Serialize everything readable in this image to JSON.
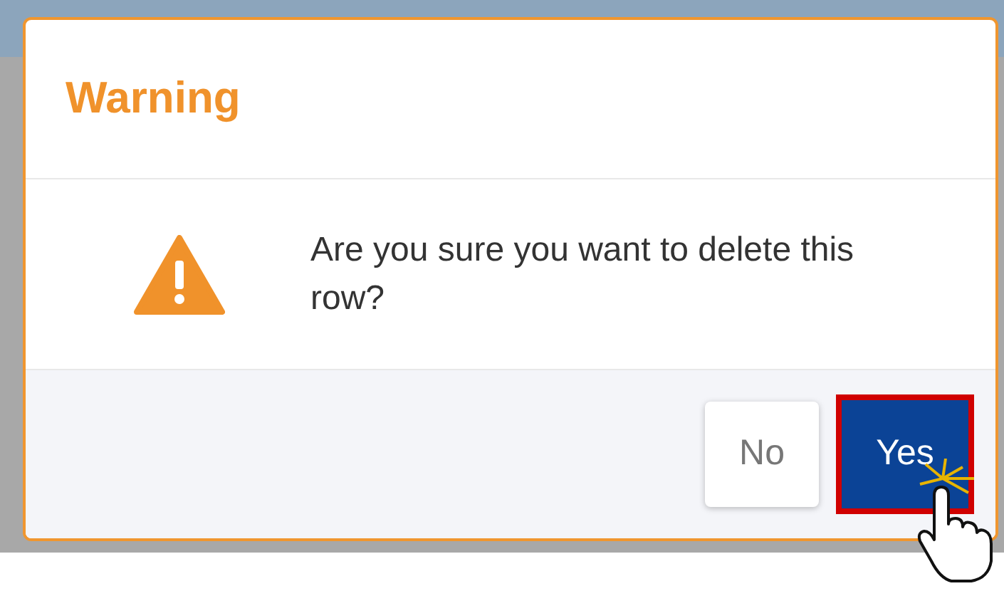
{
  "dialog": {
    "title": "Warning",
    "message": "Are you sure you want to delete this row?",
    "buttons": [
      {
        "label": "No",
        "kind": "secondary",
        "focused": false
      },
      {
        "label": "Yes",
        "kind": "primary",
        "focused": true
      }
    ]
  }
}
